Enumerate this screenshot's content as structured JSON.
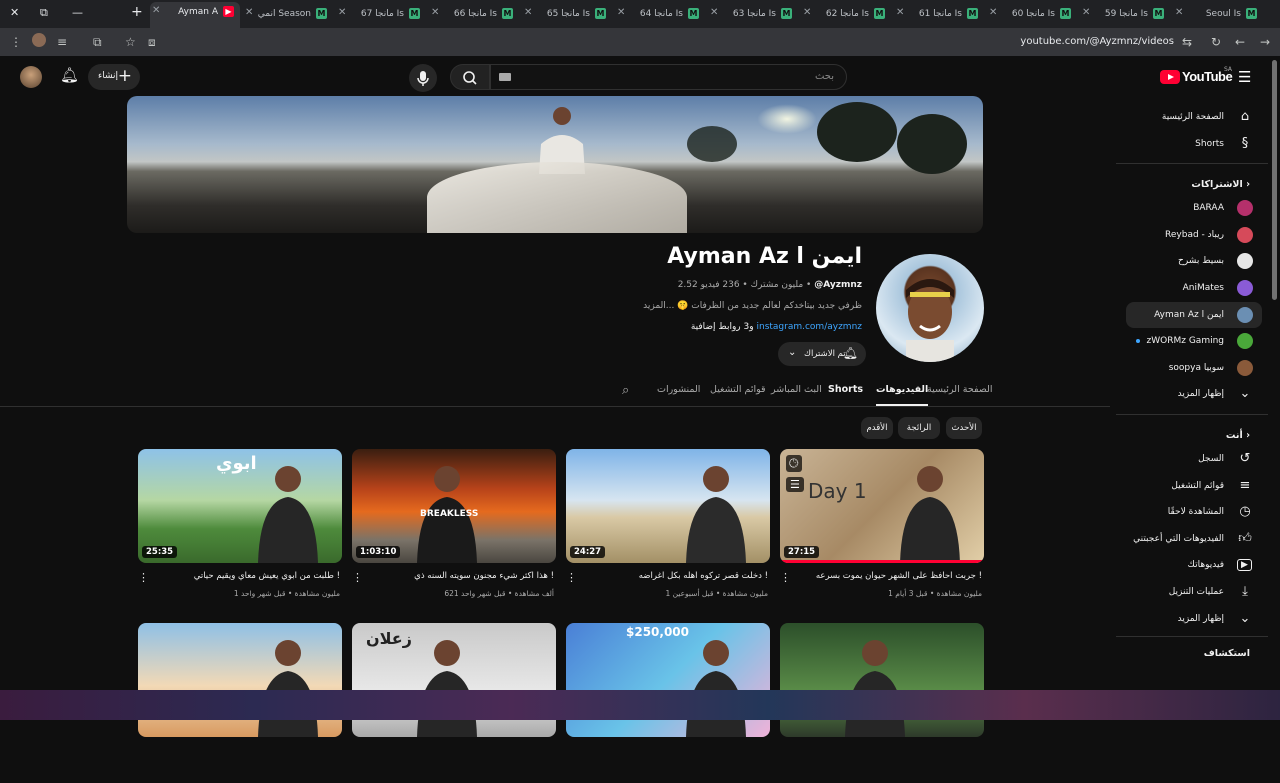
{
  "browser": {
    "tabs": [
      {
        "title": "Ayman A",
        "active": true
      },
      {
        "title": "أنمي Season"
      },
      {
        "title": "مانجا 67 Is"
      },
      {
        "title": "مانجا 66 Is"
      },
      {
        "title": "مانجا 65 Is"
      },
      {
        "title": "مانجا 64 Is"
      },
      {
        "title": "مانجا 63 Is"
      },
      {
        "title": "مانجا 62 Is"
      },
      {
        "title": "مانجا 61 Is"
      },
      {
        "title": "مانجا 60 Is"
      },
      {
        "title": "مانجا 59 Is"
      },
      {
        "title": "Seoul Is"
      }
    ],
    "url": "youtube.com/@Ayzmnz/videos",
    "tab_favicon_letter": "M"
  },
  "youtube": {
    "logo_text": "YouTube",
    "logo_region": "SA",
    "search_placeholder": "بحث",
    "create_label": "إنشاء"
  },
  "sidebar": {
    "top": [
      {
        "label": "الصفحة الرئيسية",
        "icon": "home-icon"
      },
      {
        "label": "Shorts",
        "icon": "shorts-icon"
      }
    ],
    "subscriptions_heading": "الاشتراكات",
    "subscriptions": [
      {
        "label": "BARAA",
        "color": "#b5306b"
      },
      {
        "label": "Reybad - ريباد",
        "color": "#d64a5a"
      },
      {
        "label": "بسيط بشرح",
        "color": "#e6e6e6"
      },
      {
        "label": "AniMates",
        "color": "#8a5bd6"
      },
      {
        "label": "Ayman Az l ايمن",
        "color": "#6b8fb3",
        "active": true
      },
      {
        "label": "zWORMz Gaming",
        "color": "#4aa83a",
        "live_dot": true
      },
      {
        "label": "soopya سوبيا",
        "color": "#8a5a3a"
      },
      {
        "label": "إظهار المزيد",
        "icon": "chevron-down-icon"
      }
    ],
    "you_heading": "أنت",
    "you": [
      {
        "label": "السجل",
        "icon": "history-icon"
      },
      {
        "label": "قوائم التشغيل",
        "icon": "playlist-icon"
      },
      {
        "label": "المشاهدة لاحقًا",
        "icon": "clock-icon"
      },
      {
        "label": "الفيديوهات التي أعجبتني",
        "icon": "thumbs-up-icon"
      },
      {
        "label": "فيديوهاتك",
        "icon": "video-icon"
      },
      {
        "label": "عمليات التنزيل",
        "icon": "download-icon"
      },
      {
        "label": "إظهار المزيد",
        "icon": "chevron-down-icon"
      }
    ],
    "explore_heading": "استكشاف"
  },
  "channel": {
    "name": "Ayman Az l ايمن",
    "handle": "@Ayzmnz",
    "stats": "2.52 مليون مشترك • 236 فيديو",
    "description": "ظرفي جديد بيتاخدكم لعالم جديد من الظرفات 🤫 ...المزيد",
    "link": "instagram.com/ayzmnz",
    "link_suffix": "و3 روابط إضافية",
    "subscribe_label": "تم الاشتراك"
  },
  "tabs": [
    "الصفحة الرئيسية",
    "الفيديوهات",
    "Shorts",
    "البث المباشر",
    "قوائم التشغيل",
    "المنشورات"
  ],
  "selected_tab": "الفيديوهات",
  "chips": [
    "الأحدث",
    "الرائجة",
    "الأقدم"
  ],
  "videos": [
    {
      "title": "جربت احافظ على الشهر حيوان يموت بسرعه !",
      "meta": "1 مليون مشاهدة • قبل 3 أيام",
      "duration": "27:15",
      "thumb_text": "Day 1"
    },
    {
      "title": "دخلت قصر تركوه اهله بكل اغراضه !",
      "meta": "1 مليون مشاهدة • قبل أسبوعين",
      "duration": "24:27"
    },
    {
      "title": "هذا اكثر شيء مجنون سويته السنه ذي !",
      "meta": "621 ألف مشاهدة • قبل شهر واحد",
      "duration": "1:03:10",
      "thumb_text": "BREAKLESS"
    },
    {
      "title": "طلبت من ابوي يعيش معاي ويقيم حياتي !",
      "meta": "1 مليون مشاهدة • قبل شهر واحد",
      "duration": "25:35",
      "thumb_text": "ابوي"
    },
    {
      "title": "",
      "meta": "",
      "duration": ""
    },
    {
      "title": "",
      "meta": "",
      "duration": "",
      "thumb_text": "$250,000"
    },
    {
      "title": "",
      "meta": "",
      "duration": "",
      "thumb_text": "زعلان"
    },
    {
      "title": "",
      "meta": "",
      "duration": ""
    }
  ]
}
